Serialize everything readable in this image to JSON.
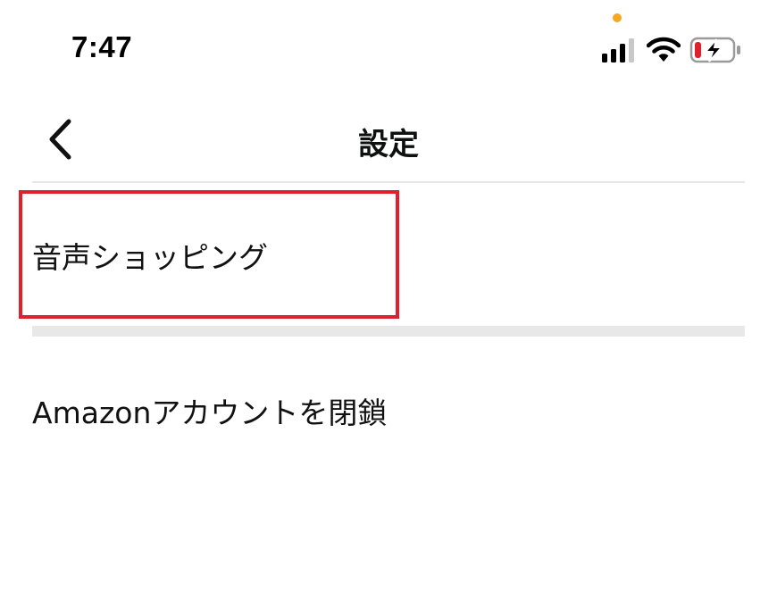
{
  "status_bar": {
    "time": "7:47",
    "icons": [
      "signal-icon",
      "wifi-icon",
      "battery-charging-icon"
    ],
    "mic_indicator_color": "#f5a623",
    "battery_level_color": "#e0202a"
  },
  "nav": {
    "back_icon": "chevron-left-icon",
    "title": "設定"
  },
  "settings_items": [
    {
      "label": "音声ショッピング",
      "highlighted": true
    },
    {
      "label": "Amazonアカウントを閉鎖",
      "highlighted": false
    }
  ],
  "colors": {
    "highlight_border": "#e0202a",
    "separator": "#e8e8e8",
    "divider": "#e6e6e6"
  }
}
